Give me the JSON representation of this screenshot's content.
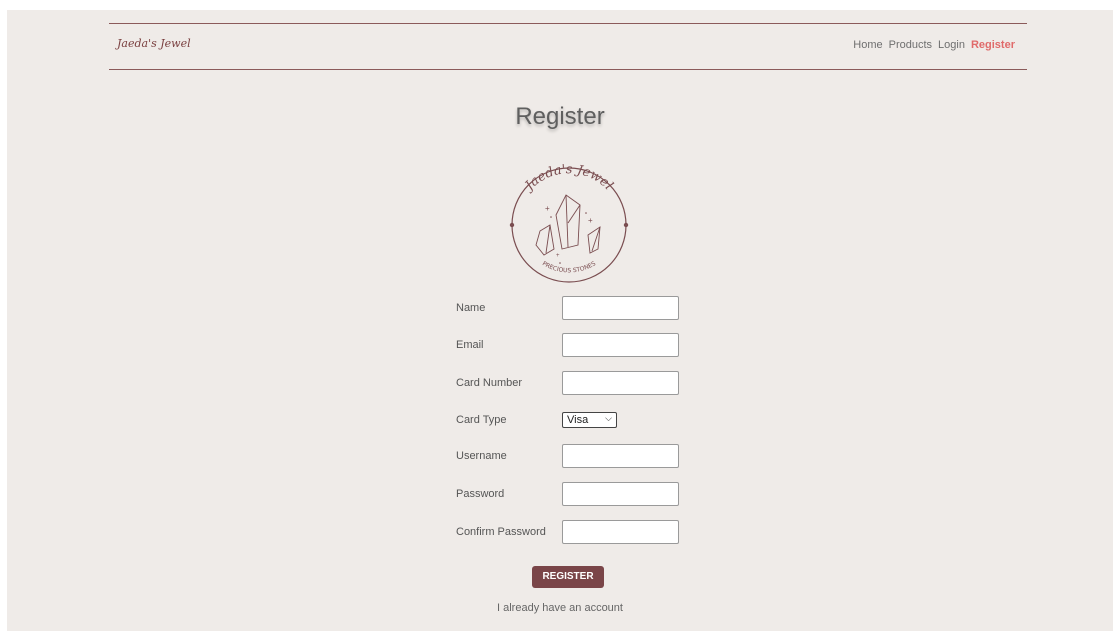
{
  "navbar": {
    "brand": "Jaeda's Jewel",
    "links": [
      {
        "label": "Home",
        "active": false
      },
      {
        "label": "Products",
        "active": false
      },
      {
        "label": "Login",
        "active": false
      },
      {
        "label": "Register",
        "active": true
      }
    ]
  },
  "page": {
    "title": "Register",
    "logo": {
      "top_text": "Jaeda's Jewel",
      "bottom_text": "PRECIOUS STONES"
    }
  },
  "form": {
    "fields": [
      {
        "label": "Name",
        "value": ""
      },
      {
        "label": "Email",
        "value": ""
      },
      {
        "label": "Card Number",
        "value": ""
      },
      {
        "label": "Card Type",
        "value": "Visa"
      },
      {
        "label": "Username",
        "value": ""
      },
      {
        "label": "Password",
        "value": ""
      },
      {
        "label": "Confirm Password",
        "value": ""
      }
    ],
    "submit_label": "REGISTER",
    "login_link": "I already have an account"
  },
  "colors": {
    "background": "#efebe8",
    "accent": "#7a4548",
    "active_link": "#e06a6a"
  }
}
